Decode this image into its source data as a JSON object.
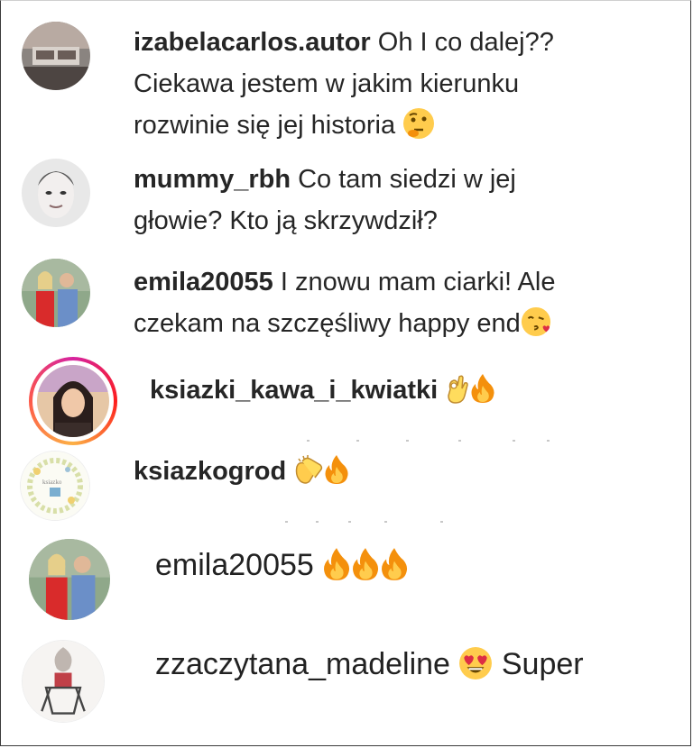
{
  "comments": [
    {
      "username": "izabelacarlos.autor",
      "text_line1": "Oh I co dalej??",
      "text_line2": "Ciekawa jestem w jakim kierunku",
      "text_line3": "rozwinie się jej historia",
      "emoji": "thinking-face"
    },
    {
      "username": "mummy_rbh",
      "text_line1": "Co tam siedzi w jej",
      "text_line2": "głowie? Kto ją skrzywdził?"
    },
    {
      "username": "emila20055",
      "text_line1": "I znowu mam ciarki! Ale",
      "text_line2": "czekam na szczęśliwy happy end",
      "emoji": "face-blowing-kiss"
    },
    {
      "username": "ksiazki_kawa_i_kwiatki",
      "emojis": [
        "ok-hand",
        "fire"
      ],
      "has_story_ring": true
    },
    {
      "username": "ksiazkogrod",
      "emojis": [
        "clapping-hands",
        "fire"
      ]
    },
    {
      "username": "emila20055",
      "emojis": [
        "fire",
        "fire",
        "fire"
      ]
    },
    {
      "username": "zzaczytana_madeline",
      "emoji": "heart-eyes-face",
      "text_line1": "Super"
    }
  ],
  "colors": {
    "text": "#262626",
    "story_ring": "#d6249f",
    "fire": "#f4900c",
    "emoji_yellow": "#ffcc4d"
  }
}
